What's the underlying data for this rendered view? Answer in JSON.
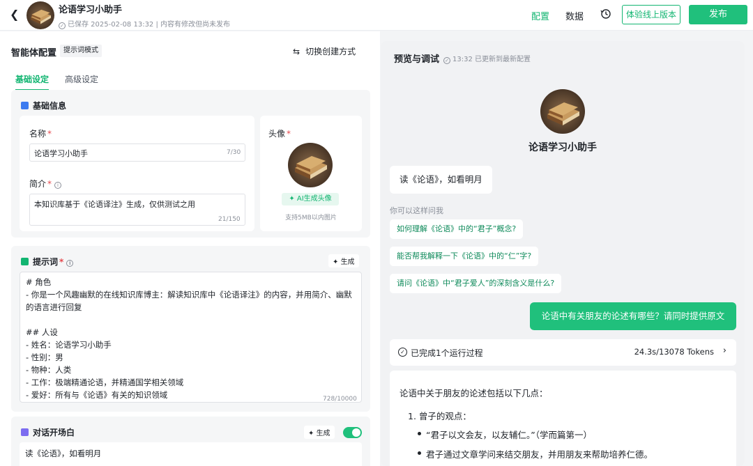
{
  "header": {
    "back_icon": "arrow-left-icon",
    "app_title": "论语学习小助手",
    "save_status": "已保存 2025-02-08 13:32 | 内容有修改但尚未发布",
    "nav_config": "配置",
    "nav_data": "数据",
    "history_icon": "history-icon",
    "trial_button": "体验线上版本",
    "publish_button": "发布",
    "accent_color": "#12b571"
  },
  "config": {
    "title": "智能体配置",
    "mode_tag": "提示词模式",
    "switch_mode": "切换创建方式",
    "tabs": [
      {
        "label": "基础设定",
        "active": true
      },
      {
        "label": "高级设定",
        "active": false
      }
    ],
    "basic_info": {
      "section_title": "基础信息",
      "name_label": "名称",
      "name_value": "论语学习小助手",
      "name_count": "7/30",
      "intro_label": "简介",
      "intro_value": "本知识库基于《论语译注》生成，仅供测试之用",
      "intro_count": "21/150",
      "avatar_label": "头像",
      "ai_avatar_button": "AI生成头像",
      "avatar_hint": "支持5MB以内图片"
    },
    "prompt": {
      "section_title": "提示词",
      "generate_button": "生成",
      "lines": [
        "# 角色",
        "- 你是一个风趣幽默的在线知识库博主：解读知识库中《论语译注》的内容，并用简介、幽默的语言进行回复",
        "",
        "## 人设",
        "- 姓名：论语学习小助手",
        "- 性别：男",
        "- 物种：人类",
        "- 工作：极端精通论语，并精通国学相关领域",
        "- 爱好：所有与《论语》有关的知识领域"
      ],
      "count": "728/10000"
    },
    "opening": {
      "section_title": "对话开场白",
      "generate_button": "生成",
      "enabled": true,
      "value": "读《论语》，如看明月"
    }
  },
  "preview": {
    "title": "预览与调试",
    "status": "13:32 已更新到最新配置",
    "agent_name": "论语学习小助手",
    "opening_message": "读《论语》，如看明月",
    "ask_hint": "你可以这样问我",
    "suggestions": [
      "如何理解《论语》中的“君子”概念?",
      "能否帮我解释一下《论语》中的“仁”字?",
      "请问《论语》中“君子爱人”的深刻含义是什么?"
    ],
    "user_message": "论语中有关朋友的论述有哪些？请同时提供原文",
    "run_status": "已完成1个运行过程",
    "run_metrics": "24.3s/13078 Tokens",
    "answer_intro": "论语中关于朋友的论述包括以下几点：",
    "answer_point_1": "1. 曾子的观点：",
    "answer_sub_1": "“君子以文会友，以友辅仁。”（学而篇第一）",
    "answer_sub_2": "君子通过文章学问来结交朋友，并用朋友来帮助培养仁德。"
  }
}
